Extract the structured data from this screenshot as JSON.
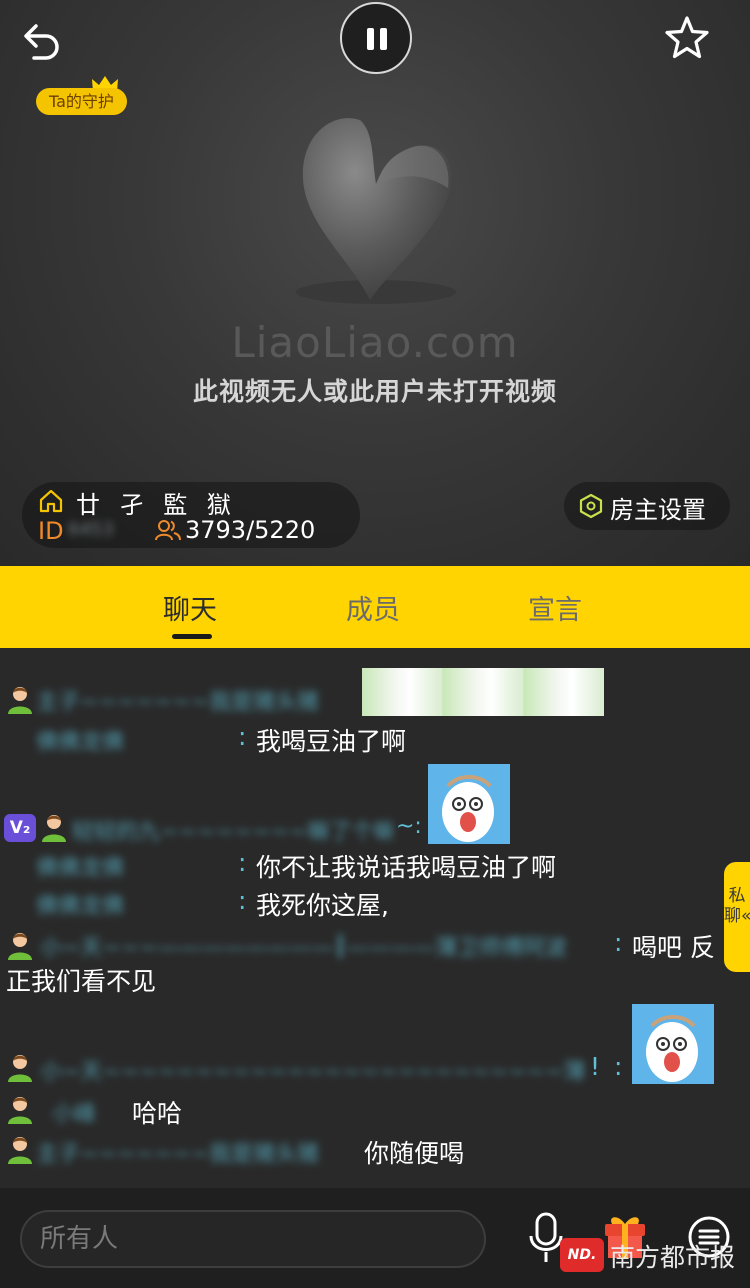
{
  "video": {
    "guard_badge": "Ta的守护",
    "brand": "LiaoLiao.com",
    "status": "此视频无人或此用户未打开视频"
  },
  "room": {
    "name": "廿 孑 監 獄",
    "id_label": "ID",
    "id_value": "6453",
    "people_count": "3793/5220",
    "host_settings": "房主设置"
  },
  "tabs": [
    {
      "label": "聊天",
      "active": true
    },
    {
      "label": "成员",
      "active": false
    },
    {
      "label": "宣言",
      "active": false
    }
  ],
  "chat": {
    "messages": [
      {
        "sender": "主子~~~~~~~我是猪头猪",
        "sender2": "佛佛龙佛",
        "text": "我喝豆油了啊"
      },
      {
        "sender": "轻轻的九~~~~~~~~嘛了个嘛",
        "sender_suffix": "~:",
        "sender2": "佛佛龙佛",
        "text": "你不让我说话我喝豆油了啊",
        "sender3": "佛佛龙佛",
        "text2": "我死你这屋,"
      },
      {
        "sender": "小~天~~~————————┃————薄卫师傅阿波",
        "text": "喝吧 反",
        "text_cont": "正我们看不见"
      },
      {
        "sender": "小~天~~~~~~~~~~~~~~~~~~~~~~~~~薄卫师傅阿波",
        "sender_suffix": "!",
        "text": ""
      },
      {
        "sender": "小峰",
        "text": "哈哈"
      },
      {
        "sender": "主子~~~~~~~我是猪头猪",
        "text": "你随便喝"
      }
    ],
    "colon": ":"
  },
  "vip_badge": "V₂",
  "private_chat": "私聊«",
  "input": {
    "placeholder": "所有人"
  },
  "watermark": {
    "logo": "ND.",
    "text": "南方都市报"
  }
}
